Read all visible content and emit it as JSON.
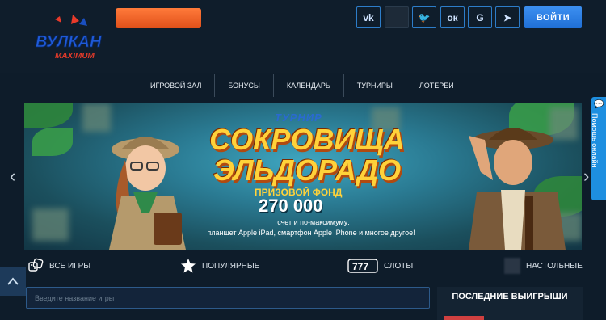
{
  "header": {
    "logo_text_main": "ВУЛКАН",
    "logo_text_sub": "MAXIMUM",
    "socials": [
      {
        "name": "vk",
        "label": "vk"
      },
      {
        "name": "blank",
        "label": ""
      },
      {
        "name": "twitter",
        "label": "🐦"
      },
      {
        "name": "odnoklassniki",
        "label": "ок"
      },
      {
        "name": "google",
        "label": "G"
      },
      {
        "name": "telegram",
        "label": "➤"
      }
    ],
    "login_label": "ВОЙТИ",
    "colors": {
      "accent": "#1f6fd6",
      "promo": "#e0501a"
    }
  },
  "nav": {
    "items": [
      "ИГРОВОЙ ЗАЛ",
      "БОНУСЫ",
      "КАЛЕНДАРЬ",
      "ТУРНИРЫ",
      "ЛОТЕРЕИ"
    ]
  },
  "banner": {
    "subtitle": "ТУРНИР",
    "title_line1": "СОКРОВИЩА",
    "title_line2": "ЭЛЬДОРАДО",
    "fund_label": "ПРИЗОВОЙ ФОНД",
    "fund_amount": "270 000",
    "line1": "счет и по-максимуму:",
    "line2": "планшет Apple iPad, смартфон Apple iPhone и многое другое!"
  },
  "side_tab": {
    "label": "Помощь онлайн"
  },
  "categories": [
    {
      "label": "ВСЕ ИГРЫ",
      "icon": "dice-icon"
    },
    {
      "label": "ПОПУЛЯРНЫЕ",
      "icon": "star-icon"
    },
    {
      "label": "СЛОТЫ",
      "icon": "slot-777-icon"
    },
    {
      "label": "НАСТОЛЬНЫЕ",
      "icon": "table-games-icon"
    }
  ],
  "search": {
    "placeholder": "Введите название игры",
    "value": ""
  },
  "last_wins": {
    "title": "ПОСЛЕДНИЕ ВЫИГРЫШИ"
  }
}
